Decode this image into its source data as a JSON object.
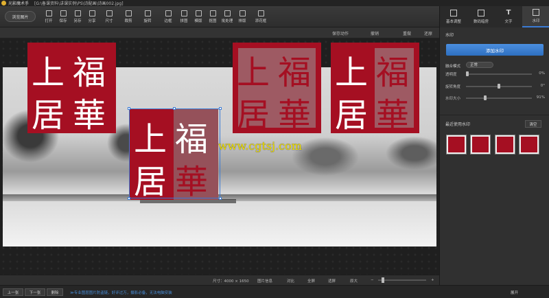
{
  "titlebar": {
    "app_name": "光影魔术手",
    "file_path": "[G:\\备课资料\\讲课实例\\PS\\诗配画\\诗画002.jpg]"
  },
  "toolbar": {
    "browse_label": "浏览图片",
    "tools": [
      "打开",
      "保存",
      "另存",
      "分享",
      "尺寸",
      "裁剪",
      "旋转",
      "边框",
      "拼图",
      "模版",
      "抠图",
      "批处理",
      "排版",
      "添花框"
    ]
  },
  "subbar": {
    "save_action": "保存动作",
    "undo": "撤销",
    "redo": "重做",
    "restore": "还原"
  },
  "status": {
    "size": "尺寸：4000 × 1650",
    "info": "图片信息",
    "compare": "对比",
    "fullscreen": "全屏",
    "fit": "适屏",
    "original": "原大",
    "zoom_minus": "−",
    "zoom_plus": "+"
  },
  "bottombar": {
    "prev": "上一张",
    "next": "下一张",
    "delete": "删除",
    "tip": "≫专业图层图片防盗链，好评过万，摄影必备，无法电脑安装",
    "expand": "展开"
  },
  "canvas": {
    "watermark_text": "www.cgtsj.com",
    "seal_chars": [
      "福",
      "華",
      "上",
      "居"
    ]
  },
  "panel": {
    "tabs": [
      {
        "label": "基本调整",
        "icon": "sliders-icon"
      },
      {
        "label": "数码暗房",
        "icon": "camera-icon"
      },
      {
        "label": "文字",
        "icon": "text-icon"
      },
      {
        "label": "水印",
        "icon": "watermark-icon"
      }
    ],
    "section_title": "水印",
    "add_button": "添加水印",
    "blend_label": "融合模式",
    "blend_value": "正常",
    "opacity_label": "透明度",
    "opacity_value": "0%",
    "rotate_label": "旋转角度",
    "rotate_value": "0°",
    "size_label": "水印大小",
    "size_value": "91%",
    "recent_title": "最近使用水印",
    "clear_button": "清空"
  },
  "colors": {
    "accent": "#3a7bd5",
    "seal_red": "#a50f22",
    "watermark_yellow": "#f4e400"
  }
}
